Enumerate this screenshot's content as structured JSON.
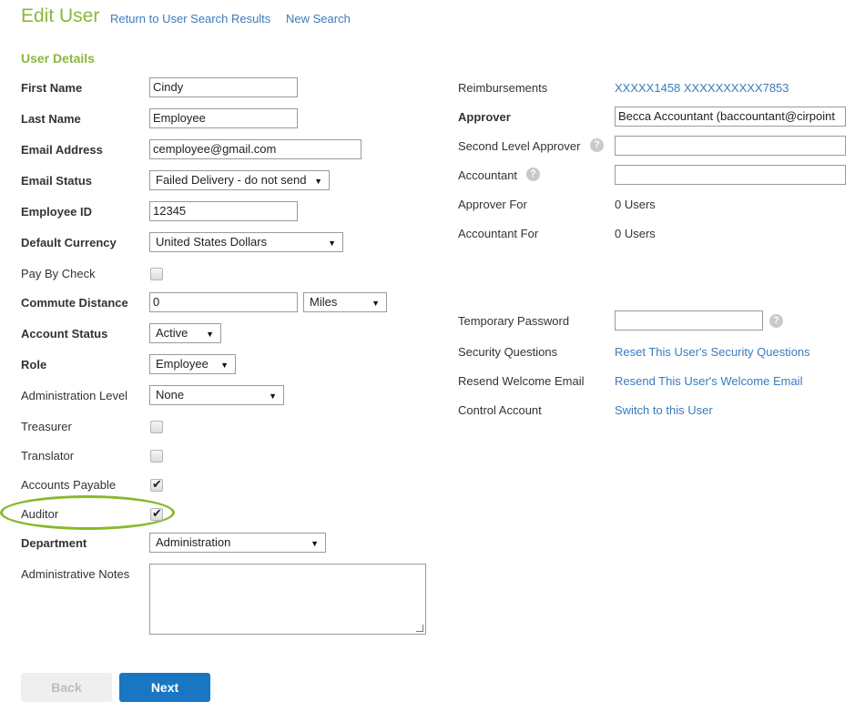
{
  "header": {
    "title": "Edit User",
    "return_link": "Return to User Search Results",
    "new_search_link": "New Search"
  },
  "section_title": "User Details",
  "fields": {
    "first_name": {
      "label": "First Name",
      "value": "Cindy"
    },
    "last_name": {
      "label": "Last Name",
      "value": "Employee"
    },
    "email": {
      "label": "Email Address",
      "value": "cemployee@gmail.com"
    },
    "email_status": {
      "label": "Email Status",
      "value": "Failed Delivery - do not send"
    },
    "employee_id": {
      "label": "Employee ID",
      "value": "12345"
    },
    "default_currency": {
      "label": "Default Currency",
      "value": "United States Dollars"
    },
    "pay_by_check": {
      "label": "Pay By Check",
      "checked": false
    },
    "commute_distance": {
      "label": "Commute Distance",
      "value": "0",
      "unit": "Miles"
    },
    "account_status": {
      "label": "Account Status",
      "value": "Active"
    },
    "role": {
      "label": "Role",
      "value": "Employee"
    },
    "administration_level": {
      "label": "Administration Level",
      "value": "None"
    },
    "treasurer": {
      "label": "Treasurer",
      "checked": false
    },
    "translator": {
      "label": "Translator",
      "checked": false
    },
    "accounts_payable": {
      "label": "Accounts Payable",
      "checked": true
    },
    "auditor": {
      "label": "Auditor",
      "checked": true
    },
    "department": {
      "label": "Department",
      "value": "Administration"
    },
    "administrative_notes": {
      "label": "Administrative Notes",
      "value": ""
    }
  },
  "right": {
    "reimbursements": {
      "label": "Reimbursements",
      "value": "XXXXX1458 XXXXXXXXXX7853"
    },
    "approver": {
      "label": "Approver",
      "value": "Becca Accountant (baccountant@cirpoint"
    },
    "second_level_approver": {
      "label": "Second Level Approver",
      "value": ""
    },
    "accountant": {
      "label": "Accountant",
      "value": ""
    },
    "approver_for": {
      "label": "Approver For",
      "value": "0 Users"
    },
    "accountant_for": {
      "label": "Accountant For",
      "value": "0 Users"
    },
    "temporary_password": {
      "label": "Temporary Password",
      "value": ""
    },
    "security_questions": {
      "label": "Security Questions",
      "link": "Reset This User's Security Questions"
    },
    "resend_welcome_email": {
      "label": "Resend Welcome Email",
      "link": "Resend This User's Welcome Email"
    },
    "control_account": {
      "label": "Control Account",
      "link": "Switch to this User"
    }
  },
  "buttons": {
    "back": "Back",
    "next": "Next"
  },
  "icons": {
    "help": "?",
    "dropdown": "▼",
    "check": "✔"
  },
  "colors": {
    "accent_green": "#8ab83c",
    "link_blue": "#3a7bbd",
    "primary_button": "#1976c2",
    "highlight_ring": "#8ab82a"
  }
}
